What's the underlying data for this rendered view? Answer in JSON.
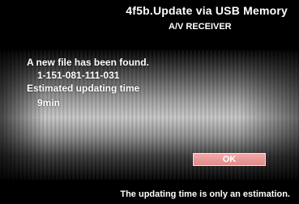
{
  "header": {
    "title": "4f5b.Update via USB Memory",
    "subtitle": "A/V RECEIVER"
  },
  "message": {
    "found": "A new file has been found.",
    "file_id": "1-151-081-111-031",
    "estimate_label": "Estimated updating time",
    "estimate_value": "9min"
  },
  "actions": {
    "ok_label": "OK"
  },
  "footer": {
    "note": "The updating time is only an estimation."
  },
  "colors": {
    "background": "#000000",
    "text": "#ffffff",
    "ok_button": "#e89a9a"
  }
}
